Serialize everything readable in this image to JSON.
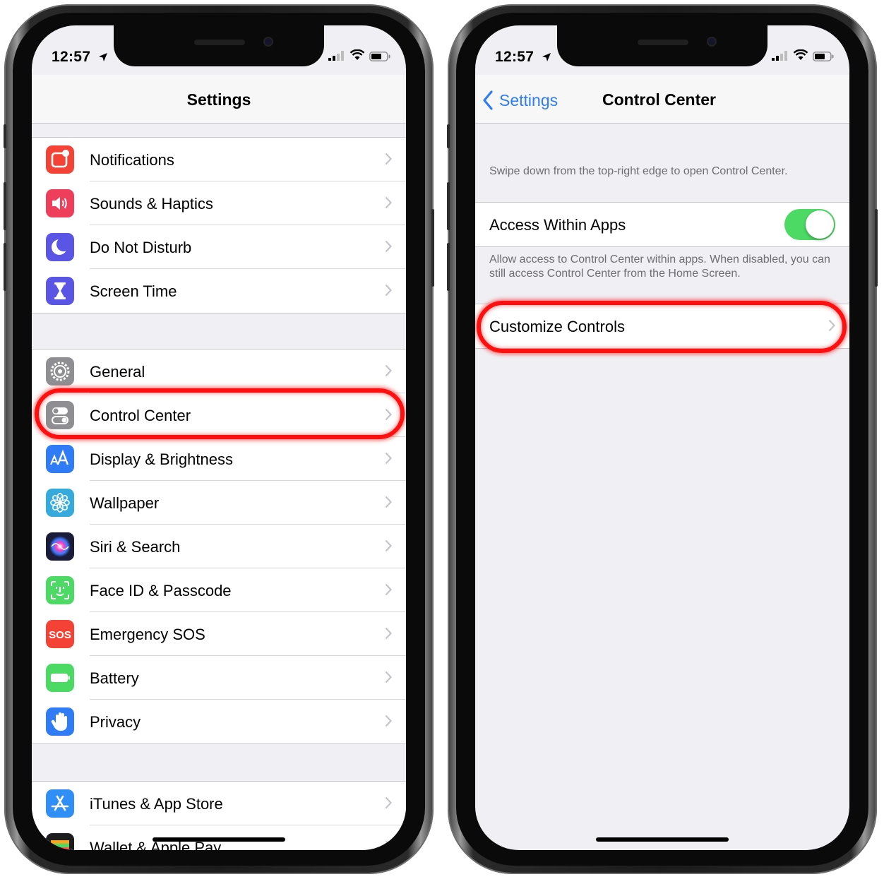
{
  "status": {
    "time": "12:57"
  },
  "left": {
    "nav_title": "Settings",
    "group1": [
      {
        "label": "Notifications",
        "icon": "notifications-icon",
        "color": "#f44336"
      },
      {
        "label": "Sounds & Haptics",
        "icon": "sounds-icon",
        "color": "#ee3e5c"
      },
      {
        "label": "Do Not Disturb",
        "icon": "moon-icon",
        "color": "#5b55e6"
      },
      {
        "label": "Screen Time",
        "icon": "hourglass-icon",
        "color": "#5b55e6"
      }
    ],
    "group2": [
      {
        "label": "General",
        "icon": "gear-icon",
        "color": "#8e8e93"
      },
      {
        "label": "Control Center",
        "icon": "toggles-icon",
        "color": "#8e8e93"
      },
      {
        "label": "Display & Brightness",
        "icon": "display-aa-icon",
        "color": "#2f7cf6"
      },
      {
        "label": "Wallpaper",
        "icon": "flower-icon",
        "color": "#36aadc"
      },
      {
        "label": "Siri & Search",
        "icon": "siri-icon",
        "color": "#1b1b3a"
      },
      {
        "label": "Face ID & Passcode",
        "icon": "face-id-icon",
        "color": "#4cd964"
      },
      {
        "label": "Emergency SOS",
        "icon": "sos-icon",
        "color": "#f44336"
      },
      {
        "label": "Battery",
        "icon": "battery-icon",
        "color": "#4cd964"
      },
      {
        "label": "Privacy",
        "icon": "hand-icon",
        "color": "#2f7cf6"
      }
    ],
    "group3": [
      {
        "label": "iTunes & App Store",
        "icon": "app-store-icon",
        "color": "#2f8ff6"
      },
      {
        "label": "Wallet & Apple Pay",
        "icon": "wallet-icon",
        "color": "#1c1c1e"
      }
    ]
  },
  "right": {
    "back_label": "Settings",
    "nav_title": "Control Center",
    "intro_text": "Swipe down from the top-right edge to open Control Center.",
    "access_label": "Access Within Apps",
    "access_enabled": true,
    "access_footer": "Allow access to Control Center within apps. When disabled, you can still access Control Center from the Home Screen.",
    "customize_label": "Customize Controls"
  },
  "colors": {
    "accent": "#2f7cf6",
    "toggle_on": "#4cd964",
    "highlight": "#ff1010"
  }
}
